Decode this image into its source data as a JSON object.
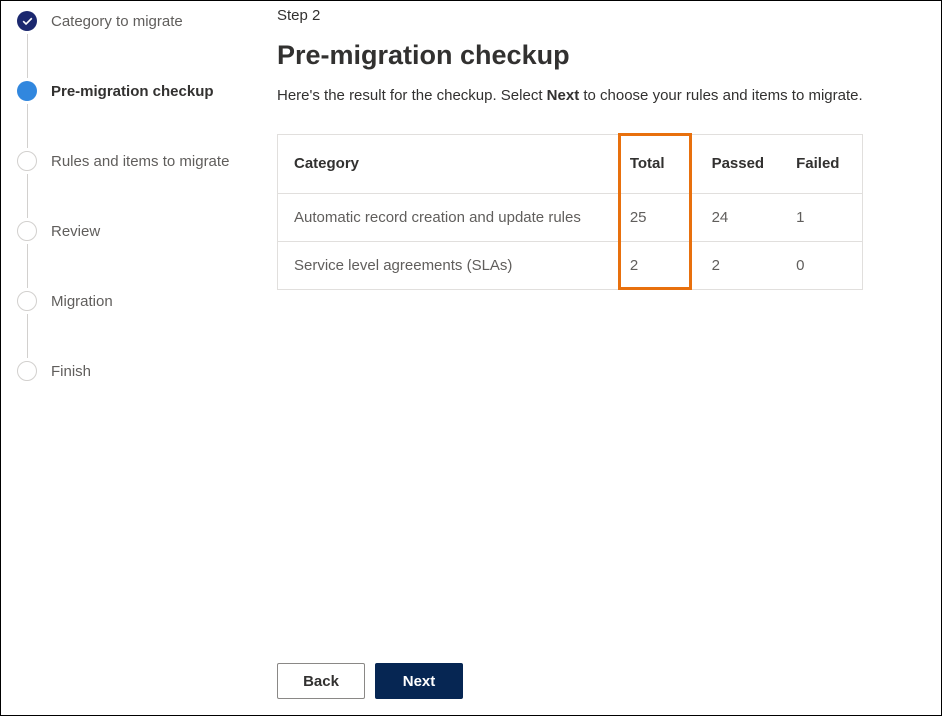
{
  "stepper": [
    {
      "label": "Category to migrate",
      "state": "done"
    },
    {
      "label": "Pre-migration checkup",
      "state": "current"
    },
    {
      "label": "Rules and items to migrate",
      "state": "pending"
    },
    {
      "label": "Review",
      "state": "pending"
    },
    {
      "label": "Migration",
      "state": "pending"
    },
    {
      "label": "Finish",
      "state": "pending"
    }
  ],
  "main": {
    "step_indicator": "Step 2",
    "title": "Pre-migration checkup",
    "description_pre": "Here's the result for the checkup. Select ",
    "description_bold": "Next",
    "description_post": " to choose your rules and items to migrate."
  },
  "table": {
    "headers": {
      "category": "Category",
      "total": "Total",
      "passed": "Passed",
      "failed": "Failed"
    },
    "rows": [
      {
        "category": "Automatic record creation and update rules",
        "total": "25",
        "passed": "24",
        "failed": "1"
      },
      {
        "category": "Service level agreements (SLAs)",
        "total": "2",
        "passed": "2",
        "failed": "0"
      }
    ]
  },
  "footer": {
    "back": "Back",
    "next": "Next"
  }
}
